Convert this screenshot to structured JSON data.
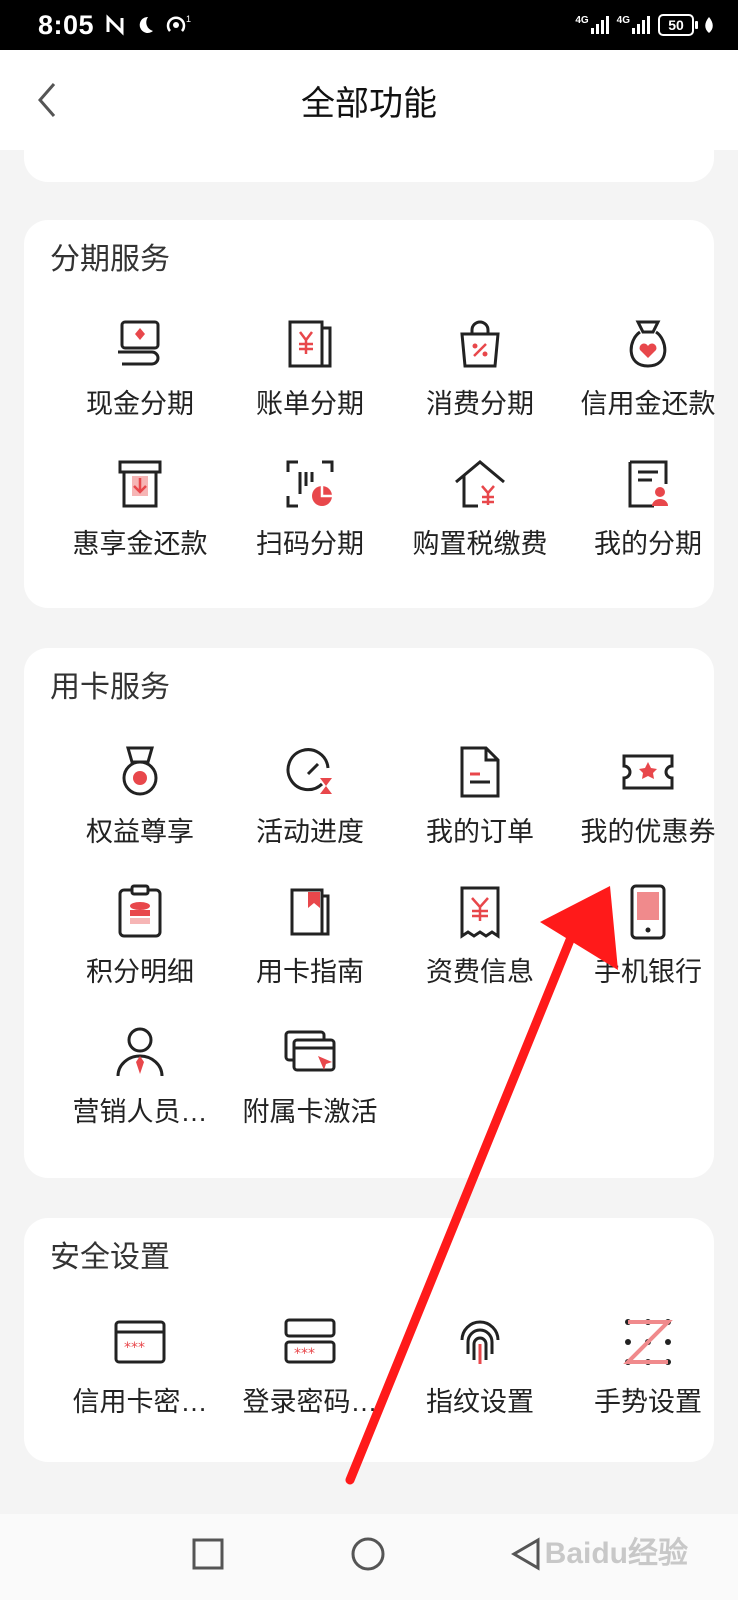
{
  "status_bar": {
    "time": "8:05",
    "net1": "4G",
    "net2": "4G",
    "battery": "50"
  },
  "header": {
    "title": "全部功能"
  },
  "sections": {
    "installment": {
      "title": "分期服务",
      "items": [
        "现金分期",
        "账单分期",
        "消费分期",
        "信用金还款",
        "惠享金还款",
        "扫码分期",
        "购置税缴费",
        "我的分期"
      ]
    },
    "card": {
      "title": "用卡服务",
      "items": [
        "权益尊享",
        "活动进度",
        "我的订单",
        "我的优惠券",
        "积分明细",
        "用卡指南",
        "资费信息",
        "手机银行",
        "营销人员…",
        "附属卡激活"
      ]
    },
    "security": {
      "title": "安全设置",
      "items": [
        "信用卡密…",
        "登录密码…",
        "指纹设置",
        "手势设置"
      ]
    }
  },
  "watermark": "Baidu经验",
  "colors": {
    "accent": "#e8474b",
    "icon_stroke": "#222222",
    "arrow": "#ff1a1a"
  }
}
